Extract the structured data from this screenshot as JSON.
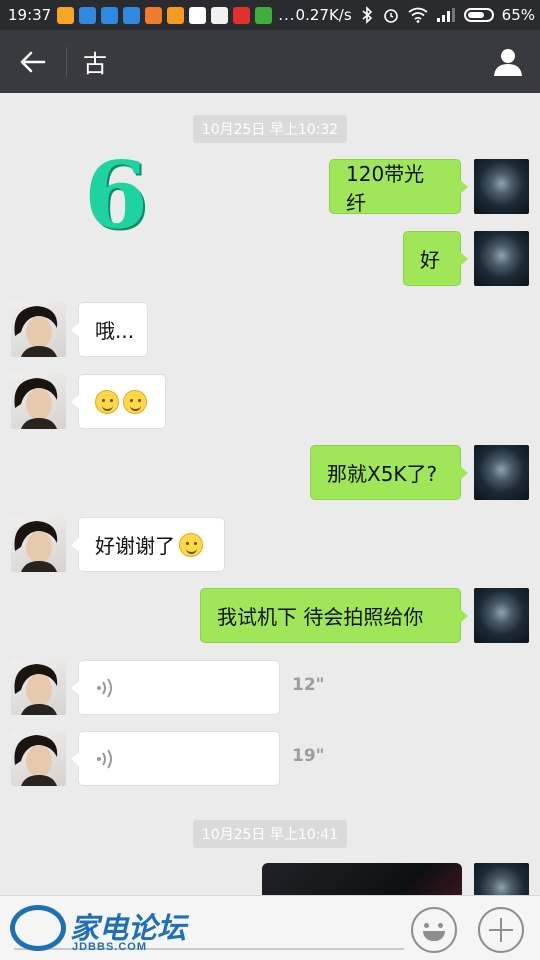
{
  "status_bar": {
    "time": "19:37",
    "dots": "...",
    "net_speed": "0.27K/s",
    "battery": "65%"
  },
  "header": {
    "title": "古"
  },
  "chat": {
    "overlay_text": "6",
    "timestamp_1": "10月25日 早上10:32",
    "timestamp_2": "10月25日 早上10:41",
    "messages": [
      {
        "text": "120带光纤"
      },
      {
        "text": "好"
      },
      {
        "text": "哦..."
      },
      {
        "text": ""
      },
      {
        "text": "那就X5K了?"
      },
      {
        "text": "好谢谢了"
      },
      {
        "text": "我试机下  待会拍照给你"
      },
      {
        "duration": "12\""
      },
      {
        "duration": "19\""
      }
    ]
  },
  "watermark": {
    "name": "家电论坛",
    "site": "JDBBS.COM"
  },
  "colors": {
    "accent_bubble": "#9fe658",
    "header_bg": "#393a3f",
    "chat_bg": "#ebebeb"
  },
  "icons": {
    "back": "back-arrow-icon",
    "profile": "person-icon",
    "emoji": "emoji-icon",
    "plus": "plus-icon"
  }
}
